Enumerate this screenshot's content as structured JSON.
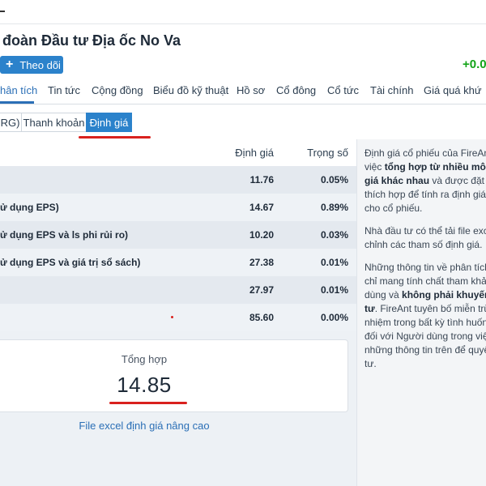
{
  "header": {
    "title": "đoàn Đầu tư Địa ốc No Va",
    "follow_plus": "+",
    "follow_label": "Theo dõi",
    "change": "+0.0"
  },
  "tabs": [
    {
      "label": "hân tích",
      "active": true
    },
    {
      "label": "Tin tức"
    },
    {
      "label": "Cộng đồng"
    },
    {
      "label": "Biểu đồ kỹ thuật"
    },
    {
      "label": "Hồ sơ"
    },
    {
      "label": "Cổ đông"
    },
    {
      "label": "Cổ tức"
    },
    {
      "label": "Tài chính"
    },
    {
      "label": "Giá quá khứ"
    }
  ],
  "subtabs": [
    {
      "label": "RG)"
    },
    {
      "label": "Thanh khoản"
    },
    {
      "label": "Định giá",
      "active": true
    }
  ],
  "table": {
    "headers": {
      "value": "Định giá",
      "weight": "Trọng số"
    },
    "rows": [
      {
        "name": "",
        "value": "11.76",
        "weight": "0.05%"
      },
      {
        "name": "ử dụng EPS)",
        "value": "14.67",
        "weight": "0.89%"
      },
      {
        "name": "ử dụng EPS và ls phi rủi ro)",
        "value": "10.20",
        "weight": "0.03%"
      },
      {
        "name": "ử dụng EPS và giá trị sổ sách)",
        "value": "27.38",
        "weight": "0.01%"
      },
      {
        "name": "",
        "value": "27.97",
        "weight": "0.01%"
      },
      {
        "name": "",
        "value": "85.60",
        "weight": "0.00%"
      }
    ]
  },
  "summary": {
    "label": "Tổng hợp",
    "value": "14.85"
  },
  "excel_link": "File excel định giá nâng cao",
  "sidebar": {
    "p1": {
      "l1": "Định giá cổ phiếu của FireAnt",
      "l2_pre": "việc ",
      "l2_bold": "tổng hợp từ nhiều mô",
      "l3_bold": "giá khác nhau",
      "l3_post": " và được đặt",
      "l4": "thích hợp để tính ra định giá",
      "l5": "cho cổ phiếu."
    },
    "p2": {
      "l1": "Nhà đầu tư có thể tải file exc",
      "l2": "chỉnh các tham số định giá."
    },
    "p3": {
      "l1": "Những thông tin về phân tích",
      "l2": "chỉ mang tính chất tham khả",
      "l3_pre": "dùng và ",
      "l3_bold": "không phải khuyến",
      "l4_bold": "tư",
      "l4_post": ". FireAnt tuyên bố miễn trừ",
      "l5": "nhiệm trong bất kỳ tình huốn",
      "l6": "đối với Người dùng trong việ",
      "l7": "những thông tin trên để quyế",
      "l8": "tư."
    }
  },
  "colors": {
    "accent": "#2b82cb",
    "positive": "#13a418",
    "annotation_red": "#d9211e",
    "panel_bg": "#edf1f5"
  }
}
